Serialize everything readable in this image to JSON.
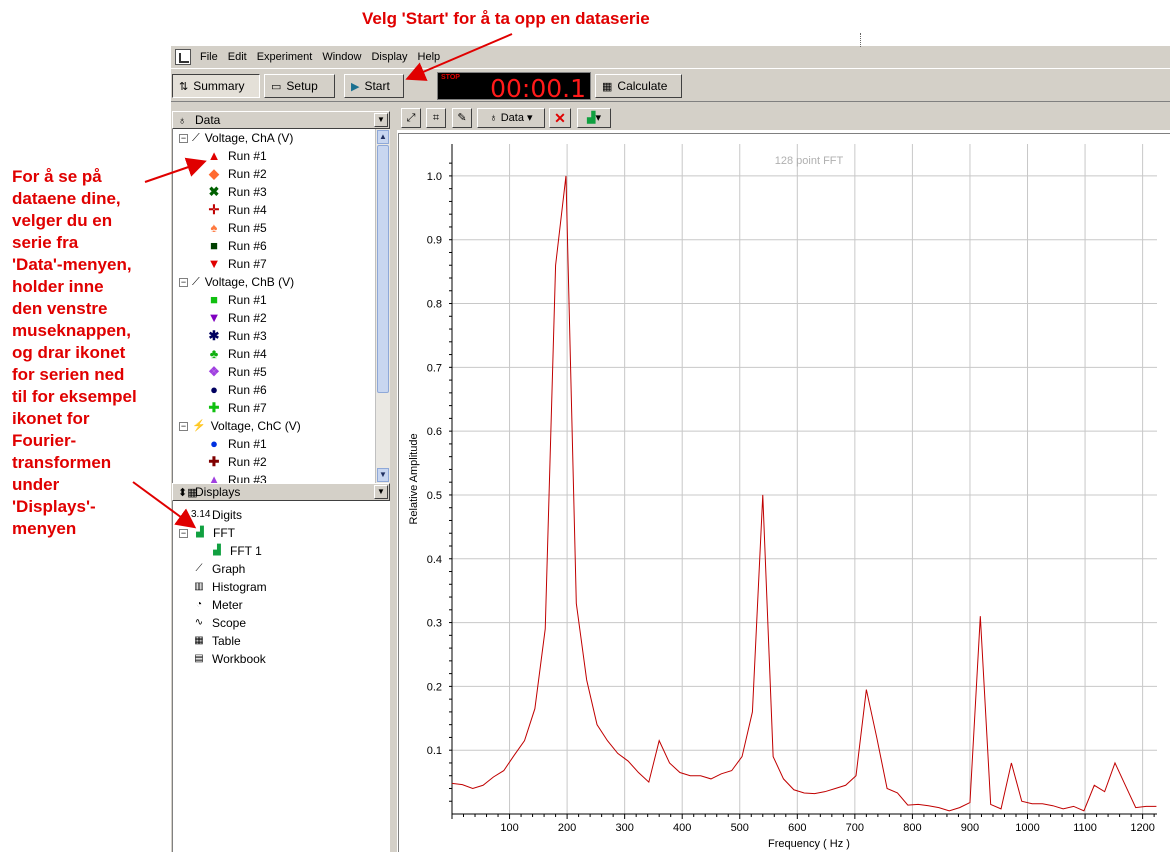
{
  "annotations": {
    "top": "Velg 'Start' for å ta opp en dataserie",
    "left_lines": [
      "For å se på",
      "dataene dine,",
      "velger du en",
      "serie fra",
      "'Data'-menyen,",
      "holder inne",
      "den venstre",
      "museknappen,",
      "og drar ikonet",
      "for serien ned",
      "til for eksempel",
      "ikonet for",
      "Fourier-",
      "transformen",
      "under",
      "'Displays'-",
      "menyen"
    ]
  },
  "menu": [
    "File",
    "Edit",
    "Experiment",
    "Window",
    "Display",
    "Help"
  ],
  "toolbar": {
    "summary_label": "Summary",
    "setup_label": "Setup",
    "start_label": "Start",
    "stop_label": "STOP",
    "timer_value": "00:00.1",
    "calculate_label": "Calculate"
  },
  "data_panel": {
    "header": "Data",
    "groups": [
      {
        "label": "Voltage, ChA (V)",
        "runs": [
          {
            "label": "Run #1",
            "symbol": "▲",
            "color": "#e00000"
          },
          {
            "label": "Run #2",
            "symbol": "◆",
            "color": "#ff6a30"
          },
          {
            "label": "Run #3",
            "symbol": "✖",
            "color": "#006000"
          },
          {
            "label": "Run #4",
            "symbol": "✛",
            "color": "#c00000"
          },
          {
            "label": "Run #5",
            "symbol": "♠",
            "color": "#ff7a40"
          },
          {
            "label": "Run #6",
            "symbol": "■",
            "color": "#004000"
          },
          {
            "label": "Run #7",
            "symbol": "▼",
            "color": "#e00000"
          }
        ]
      },
      {
        "label": "Voltage, ChB (V)",
        "runs": [
          {
            "label": "Run #1",
            "symbol": "■",
            "color": "#10c010"
          },
          {
            "label": "Run #2",
            "symbol": "▼",
            "color": "#8000c0"
          },
          {
            "label": "Run #3",
            "symbol": "✱",
            "color": "#000060"
          },
          {
            "label": "Run #4",
            "symbol": "♣",
            "color": "#10b010"
          },
          {
            "label": "Run #5",
            "symbol": "❖",
            "color": "#a040e0"
          },
          {
            "label": "Run #6",
            "symbol": "●",
            "color": "#000060"
          },
          {
            "label": "Run #7",
            "symbol": "✚",
            "color": "#10c010"
          }
        ]
      },
      {
        "label": "Voltage, ChC (V)",
        "runs": [
          {
            "label": "Run #1",
            "symbol": "●",
            "color": "#0030e0"
          },
          {
            "label": "Run #2",
            "symbol": "✚",
            "color": "#800000"
          },
          {
            "label": "Run #3",
            "symbol": "▲",
            "color": "#a040e0"
          }
        ]
      }
    ]
  },
  "displays_panel": {
    "header": "Displays",
    "items": [
      {
        "label": "Digits",
        "icon": "digits-icon",
        "glyph": "3.14"
      },
      {
        "label": "FFT",
        "icon": "fft-icon",
        "glyph": "▟"
      },
      {
        "label": "FFT 1",
        "icon": "fft-icon",
        "glyph": "▟"
      },
      {
        "label": "Graph",
        "icon": "graph-icon",
        "glyph": "⟋"
      },
      {
        "label": "Histogram",
        "icon": "histogram-icon",
        "glyph": "▥"
      },
      {
        "label": "Meter",
        "icon": "meter-icon",
        "glyph": "◔"
      },
      {
        "label": "Scope",
        "icon": "scope-icon",
        "glyph": "∿"
      },
      {
        "label": "Table",
        "icon": "table-icon",
        "glyph": "▦"
      },
      {
        "label": "Workbook",
        "icon": "workbook-icon",
        "glyph": "▤"
      }
    ]
  },
  "chart_toolbar": {
    "data_label": "Data"
  },
  "chart_data": {
    "type": "line",
    "title": "128 point FFT",
    "xlabel": "Frequency ( Hz )",
    "ylabel": "Relative Amplitude",
    "xlim": [
      0,
      1225
    ],
    "ylim": [
      0,
      1.05
    ],
    "x_ticks": [
      100,
      200,
      300,
      400,
      500,
      600,
      700,
      800,
      900,
      1000,
      1100,
      1200
    ],
    "y_ticks": [
      0.1,
      0.2,
      0.3,
      0.4,
      0.5,
      0.6,
      0.7,
      0.8,
      0.9,
      1.0
    ],
    "y_tick_labels": [
      "0.1",
      "0.2",
      "0.3",
      "0.4",
      "0.5",
      "0.6",
      "0.7",
      "0.8",
      "0.9",
      "1.0"
    ],
    "grid": true,
    "line_color": "#c00000",
    "x": [
      0,
      18,
      36,
      54,
      72,
      90,
      108,
      126,
      144,
      162,
      180,
      198,
      216,
      234,
      252,
      270,
      288,
      306,
      324,
      342,
      360,
      378,
      396,
      414,
      432,
      450,
      468,
      486,
      504,
      522,
      540,
      558,
      576,
      594,
      612,
      630,
      648,
      666,
      684,
      702,
      720,
      738,
      756,
      774,
      792,
      810,
      828,
      846,
      864,
      882,
      900,
      918,
      936,
      954,
      972,
      990,
      1008,
      1026,
      1044,
      1062,
      1080,
      1098,
      1116,
      1134,
      1152,
      1170,
      1188,
      1206,
      1224
    ],
    "y": [
      0.048,
      0.046,
      0.04,
      0.045,
      0.058,
      0.068,
      0.092,
      0.115,
      0.165,
      0.29,
      0.86,
      1.0,
      0.33,
      0.21,
      0.14,
      0.115,
      0.095,
      0.083,
      0.065,
      0.05,
      0.115,
      0.08,
      0.065,
      0.06,
      0.06,
      0.055,
      0.063,
      0.068,
      0.09,
      0.16,
      0.5,
      0.09,
      0.055,
      0.038,
      0.033,
      0.032,
      0.035,
      0.04,
      0.045,
      0.06,
      0.195,
      0.12,
      0.04,
      0.033,
      0.014,
      0.015,
      0.013,
      0.01,
      0.005,
      0.01,
      0.018,
      0.31,
      0.015,
      0.008,
      0.08,
      0.02,
      0.016,
      0.016,
      0.013,
      0.008,
      0.012,
      0.005,
      0.045,
      0.035,
      0.08,
      0.045,
      0.01,
      0.012,
      0.012
    ]
  }
}
